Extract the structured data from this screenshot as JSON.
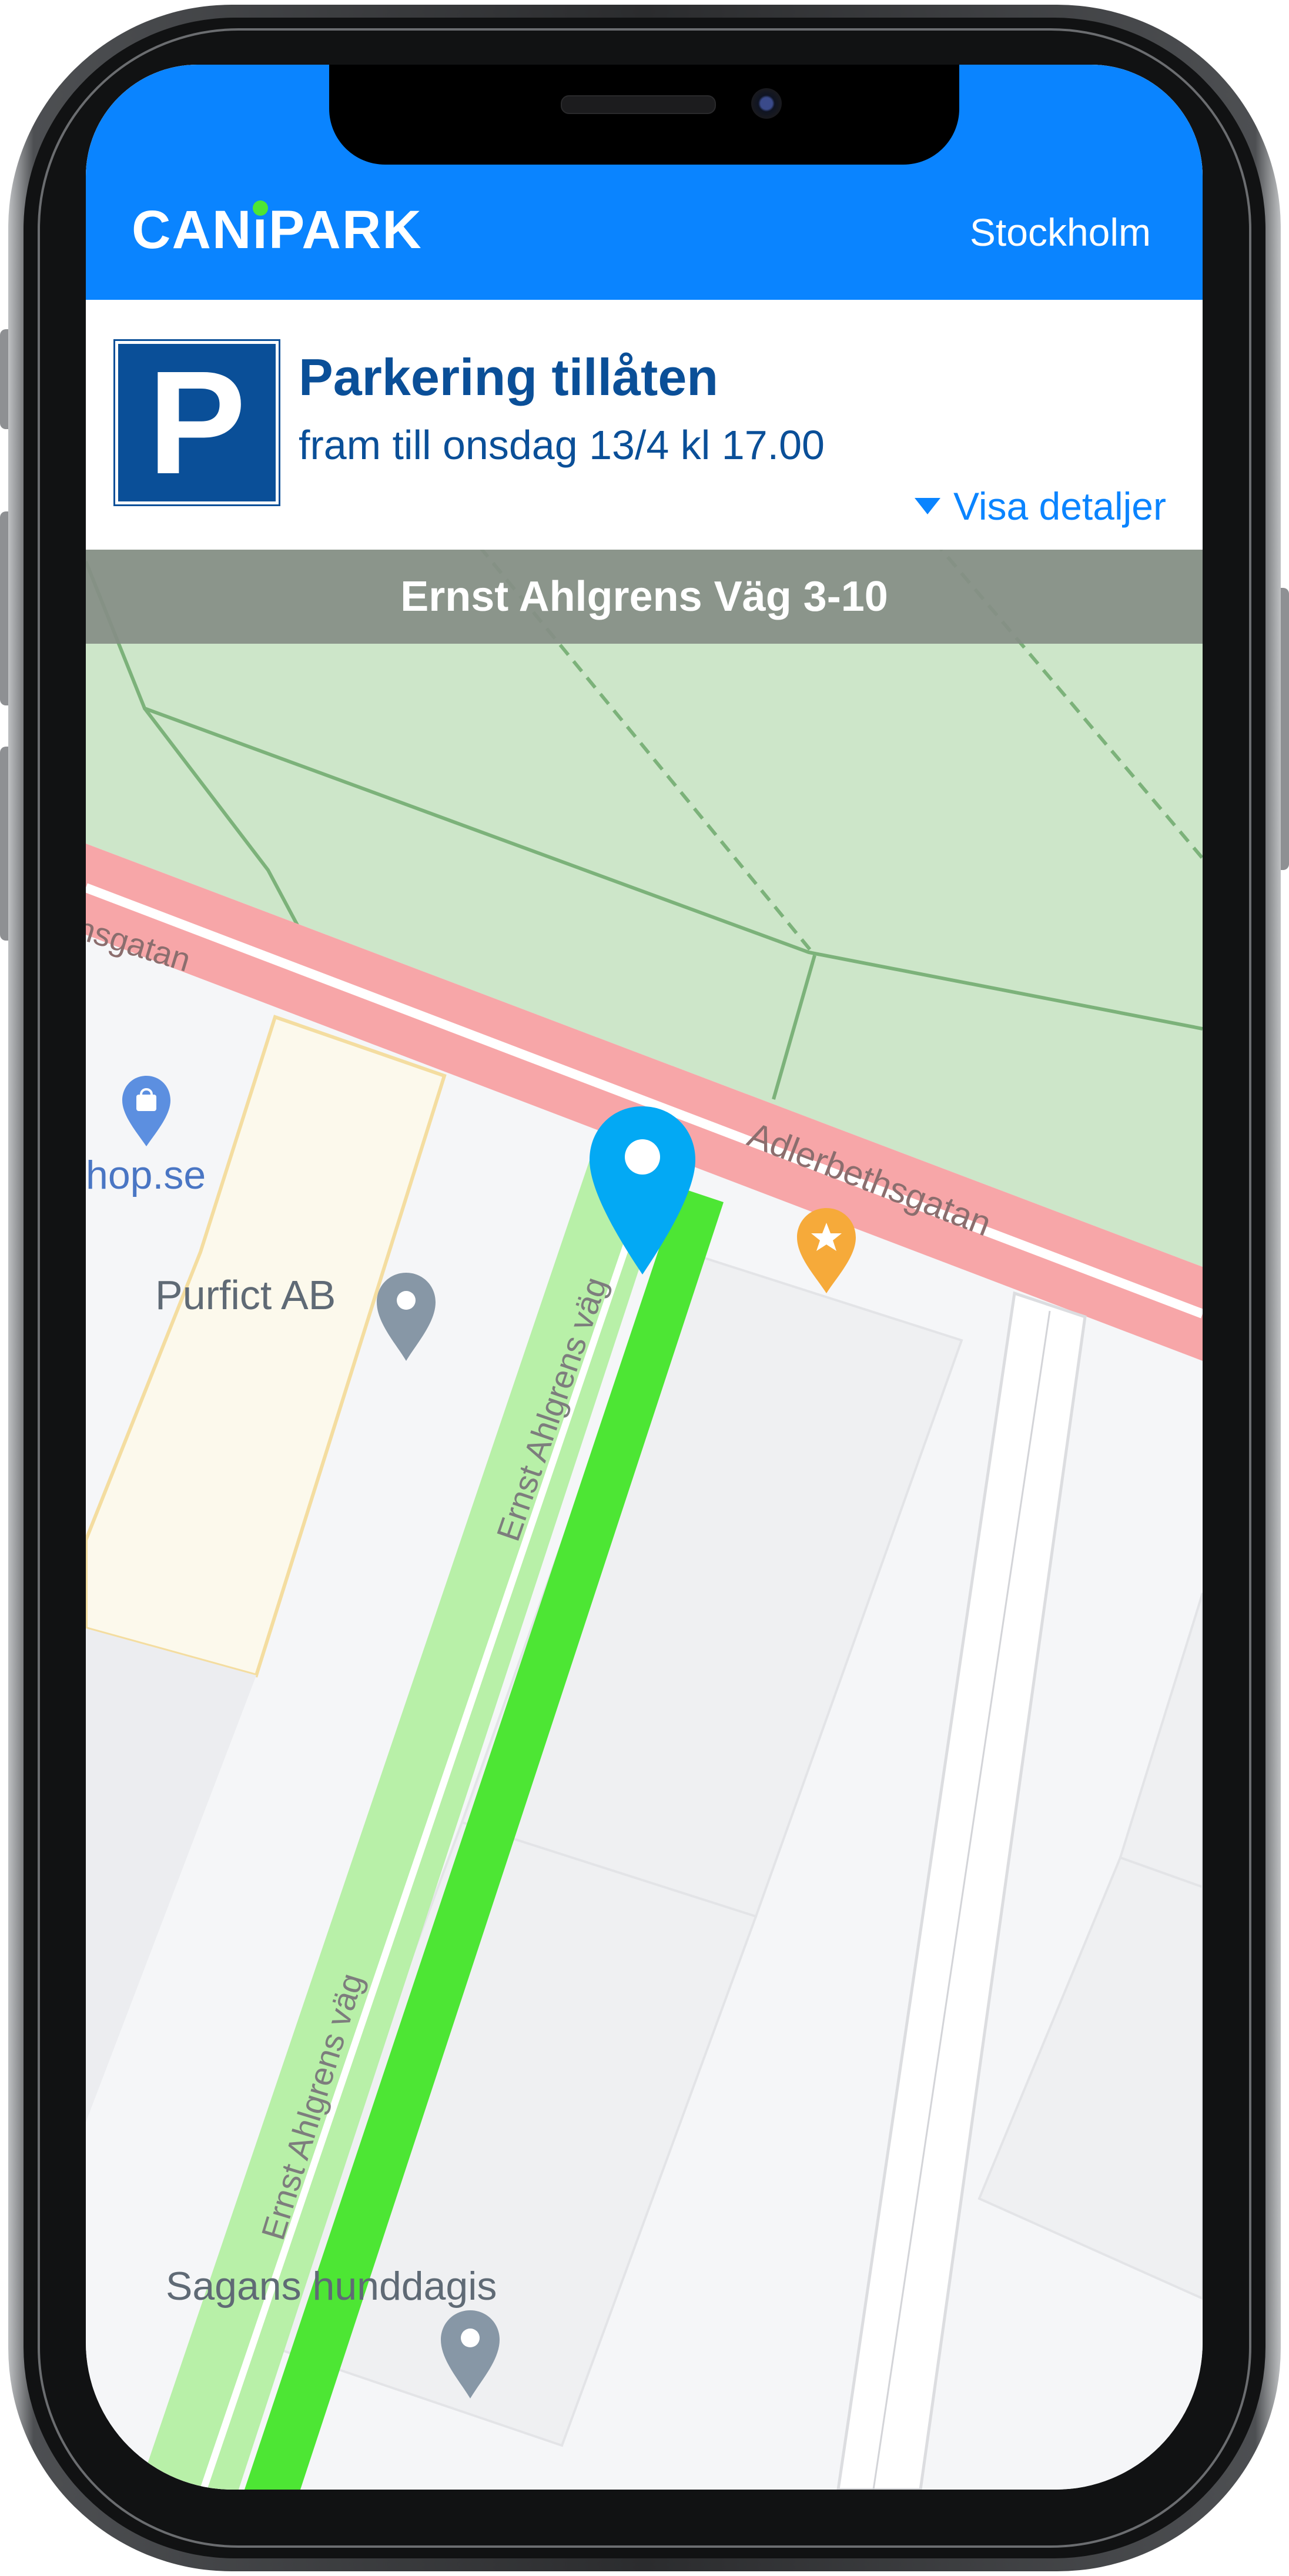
{
  "app": {
    "brand_name": "CANiPARK",
    "city": "Stockholm"
  },
  "status": {
    "sign_letter": "P",
    "title": "Parkering tillåten",
    "subtitle": "fram till onsdag 13/4 kl 17.00",
    "details_label": "Visa detaljer"
  },
  "street_bar": {
    "name": "Ernst Ahlgrens Väg 3-10"
  },
  "map": {
    "street_labels": {
      "left_street": "nsgatan",
      "adlerbethsgatan": "Adlerbethsgatan",
      "ernst_upper": "Ernst Ahlgrens väg",
      "ernst_lower": "Ernst Ahlgrens väg"
    },
    "places": {
      "shop": "hop.se",
      "purfict": "Purfict AB",
      "hunddagis": "Sagans hunddagis"
    },
    "selected_pin_icon": "location-pin-icon",
    "colors": {
      "park": "#cde6c9",
      "road": "#f7a6a8",
      "permitted_parking": "#4de634",
      "pin": "#03a9f4"
    }
  }
}
